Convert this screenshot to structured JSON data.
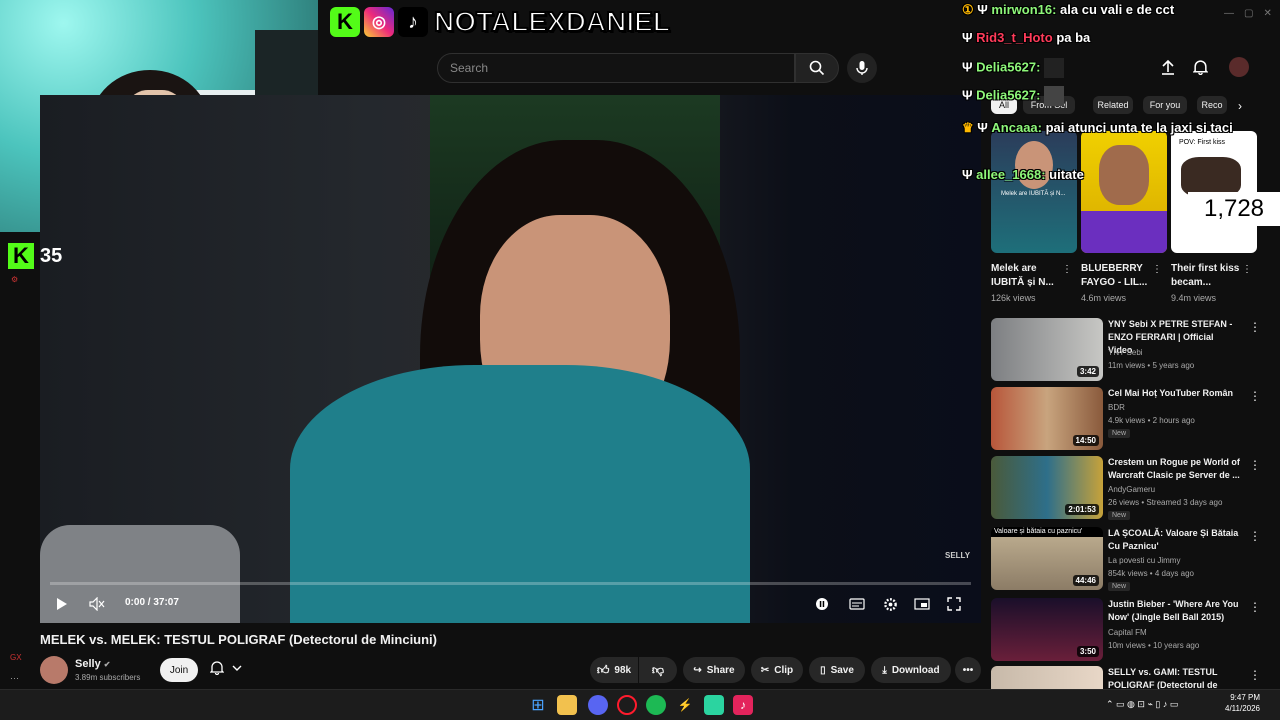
{
  "overlay": {
    "brand_name": "NOTALEXDANIEL",
    "kick_count": "35",
    "viewer_count": "1,728"
  },
  "chat": [
    {
      "user": "mirwon16:",
      "msg": "ala cu vali e de cct"
    },
    {
      "user": "Rid3_t_Hoto",
      "msg": "pa ba"
    },
    {
      "user": "Delia5627:",
      "msg": ""
    },
    {
      "user": "Delia5627:",
      "msg": ""
    },
    {
      "user": "Ancaaa:",
      "msg": "pai atunci unta te la jaxi si taci"
    },
    {
      "user": "allee_1668:",
      "msg": "uitate"
    }
  ],
  "search": {
    "placeholder": "Search"
  },
  "player": {
    "time": "0:00 / 37:07",
    "watermark": "SELLY"
  },
  "video": {
    "title": "MELEK vs. MELEK: TESTUL POLIGRAF (Detectorul de Minciuni)",
    "channel": "Selly",
    "subscribers": "3.89m subscribers",
    "join_label": "Join",
    "like_count": "98k",
    "share_label": "Share",
    "clip_label": "Clip",
    "save_label": "Save",
    "download_label": "Download"
  },
  "chips": [
    "All",
    "From Sel",
    "Related",
    "For you",
    "Reco"
  ],
  "shorts": [
    {
      "title": "Melek are IUBITĂ și N...",
      "views": "126k views",
      "thumb_text": "Melek are IUBITĂ și N..."
    },
    {
      "title": "BLUEBERRY FAYGO - LIL...",
      "views": "4.6m views",
      "thumb_text": ""
    },
    {
      "title": "Their first kiss becam...",
      "views": "9.4m views",
      "thumb_text": "POV: First kiss"
    }
  ],
  "recommendations": [
    {
      "title": "YNY Sebi X PETRE STEFAN - ENZO FERRARI | Official Video",
      "channel": "YNY Sebi",
      "meta": "11m views • 5 years ago",
      "duration": "3:42",
      "new": ""
    },
    {
      "title": "Cel Mai Hoț YouTuber Român",
      "channel": "BDR",
      "meta": "4.9k views • 2 hours ago",
      "duration": "14:50",
      "new": "New"
    },
    {
      "title": "Crestem un Rogue pe World of Warcraft Clasic pe Server de ...",
      "channel": "AndyGameru",
      "meta": "26 views • Streamed 3 days ago",
      "duration": "2:01:53",
      "new": "New"
    },
    {
      "title": "LA ȘCOALĂ: Valoare Și Bătaia Cu Paznicu'",
      "channel": "La povesti cu Jimmy",
      "meta": "854k views • 4 days ago",
      "duration": "44:46",
      "new": "New",
      "thumb_caption": "Valoare și bătaia cu paznicu'"
    },
    {
      "title": "Justin Bieber - 'Where Are You Now' (Jingle Bell Ball 2015)",
      "channel": "Capital FM",
      "meta": "10m views • 10 years ago",
      "duration": "3:50",
      "new": ""
    },
    {
      "title": "SELLY vs. GAMI: TESTUL POLIGRAF (Detectorul de",
      "channel": "",
      "meta": "",
      "duration": "",
      "new": ""
    }
  ],
  "taskbar": {
    "time": "9:47 PM",
    "date": "4/11/2026"
  },
  "colors": {
    "kick_green": "#53fc18",
    "bg": "#0f0f0f",
    "chip_bg": "#272727"
  }
}
